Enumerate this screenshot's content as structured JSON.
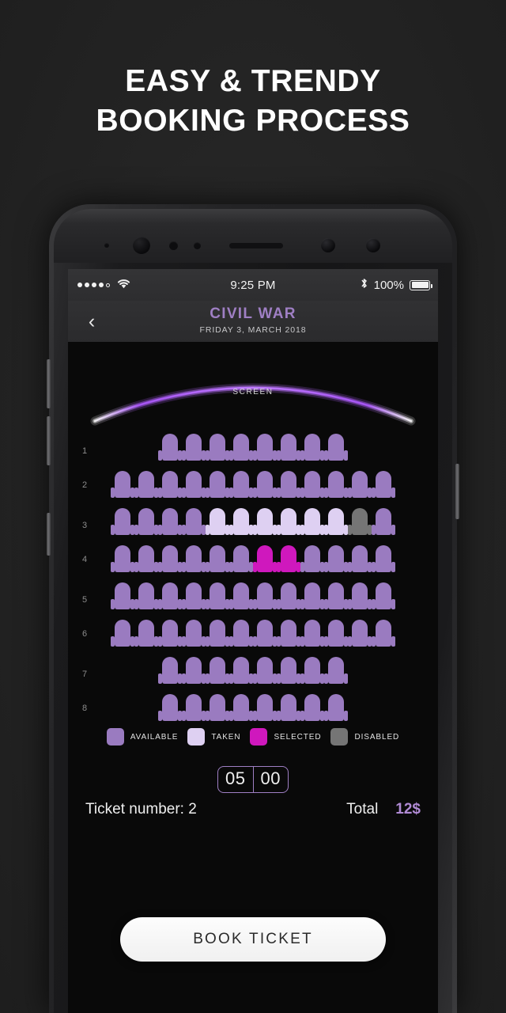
{
  "headline": {
    "line1": "EASY & TRENDY",
    "line2": "BOOKING PROCESS"
  },
  "status_bar": {
    "signal_dots_filled": 4,
    "signal_dots_empty": 1,
    "wifi_icon": "wifi-icon",
    "time": "9:25 PM",
    "bluetooth_icon": "bluetooth-icon",
    "battery_percent": "100%"
  },
  "nav": {
    "back_icon": "chevron-left-icon",
    "title": "CIVIL WAR",
    "subtitle": "FRIDAY 3, MARCH 2018"
  },
  "screen_arc": {
    "label": "SCREEN",
    "color": "#a855f7"
  },
  "colors": {
    "available": "#9a7bc0",
    "taken": "#ded0f2",
    "selected": "#cf18bd",
    "disabled": "#757575"
  },
  "seatmap": {
    "rows": [
      {
        "number": "1",
        "seats": [
          "available",
          "available",
          "available",
          "available",
          "available",
          "available",
          "available",
          "available"
        ]
      },
      {
        "number": "2",
        "seats": [
          "available",
          "available",
          "available",
          "available",
          "available",
          "available",
          "available",
          "available",
          "available",
          "available",
          "available",
          "available"
        ]
      },
      {
        "number": "3",
        "seats": [
          "available",
          "available",
          "available",
          "available",
          "taken",
          "taken",
          "taken",
          "taken",
          "taken",
          "taken",
          "disabled",
          "available"
        ]
      },
      {
        "number": "4",
        "seats": [
          "available",
          "available",
          "available",
          "available",
          "available",
          "available",
          "selected",
          "selected",
          "available",
          "available",
          "available",
          "available"
        ]
      },
      {
        "number": "5",
        "seats": [
          "available",
          "available",
          "available",
          "available",
          "available",
          "available",
          "available",
          "available",
          "available",
          "available",
          "available",
          "available"
        ]
      },
      {
        "number": "6",
        "seats": [
          "available",
          "available",
          "available",
          "available",
          "available",
          "available",
          "available",
          "available",
          "available",
          "available",
          "available",
          "available"
        ]
      },
      {
        "number": "7",
        "seats": [
          "available",
          "available",
          "available",
          "available",
          "available",
          "available",
          "available",
          "available"
        ]
      },
      {
        "number": "8",
        "seats": [
          "available",
          "available",
          "available",
          "available",
          "available",
          "available",
          "available",
          "available"
        ]
      }
    ]
  },
  "legend": [
    {
      "label": "AVAILABLE",
      "state": "available"
    },
    {
      "label": "TAKEN",
      "state": "taken"
    },
    {
      "label": "SELECTED",
      "state": "selected"
    },
    {
      "label": "DISABLED",
      "state": "disabled"
    }
  ],
  "timer": {
    "minutes": "05",
    "seconds": "00"
  },
  "summary": {
    "ticket_label": "Ticket number: 2",
    "total_label": "Total",
    "total_value": "12$"
  },
  "book_button": {
    "label": "BOOK TICKET"
  }
}
